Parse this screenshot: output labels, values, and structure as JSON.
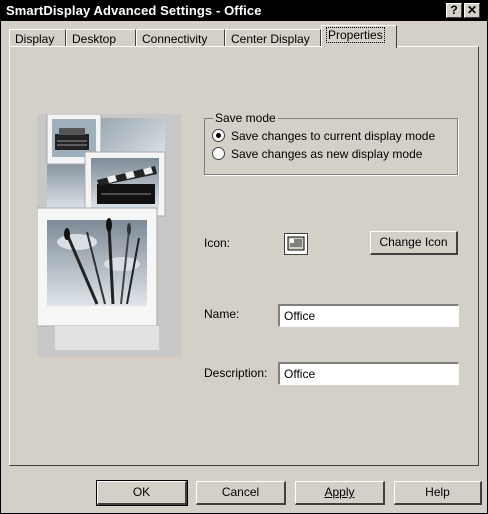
{
  "window": {
    "title": "SmartDisplay Advanced Settings - Office",
    "help_button": "?",
    "close_button": "✕"
  },
  "tabs": [
    {
      "label": "Display"
    },
    {
      "label": "Desktop"
    },
    {
      "label": "Connectivity"
    },
    {
      "label": "Center Display"
    },
    {
      "label": "Properties",
      "active": true
    }
  ],
  "save_mode": {
    "legend": "Save mode",
    "options": [
      {
        "label": "Save changes to current display mode",
        "selected": true
      },
      {
        "label": "Save changes as new display mode",
        "selected": false
      }
    ]
  },
  "icon": {
    "label": "Icon:",
    "icon_name": "display-mode-icon",
    "change_button": "Change Icon"
  },
  "name": {
    "label": "Name:",
    "value": "Office"
  },
  "description": {
    "label": "Description:",
    "value": "Office"
  },
  "illustration": {
    "icon_name": "display-mode-collage-illustration"
  },
  "footer": {
    "ok": "OK",
    "cancel": "Cancel",
    "apply": "Apply",
    "help": "Help"
  },
  "colors": {
    "window_bg": "#d4d0c8",
    "titlebar_bg": "#000000"
  }
}
